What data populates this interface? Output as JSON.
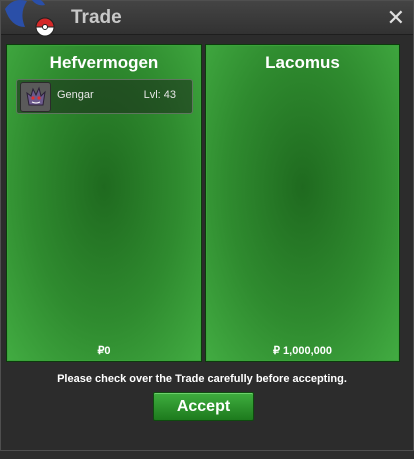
{
  "window": {
    "title": "Trade",
    "close_glyph": "✕",
    "logo_icon": "pokeball-logo-icon"
  },
  "left_panel": {
    "player_name": "Hefvermogen",
    "items": [
      {
        "name": "Gengar",
        "level": "Lvl: 43",
        "icon": "gengar-sprite-icon"
      }
    ],
    "money": "₽0"
  },
  "right_panel": {
    "player_name": "Lacomus",
    "items": [],
    "money": "₽ 1,000,000"
  },
  "notice": "Please check over the Trade carefully before accepting.",
  "accept_label": "Accept",
  "colors": {
    "panel_green": "#2f8b2f",
    "accept_green": "#2a942a",
    "titlebar": "#3a3a3a"
  }
}
